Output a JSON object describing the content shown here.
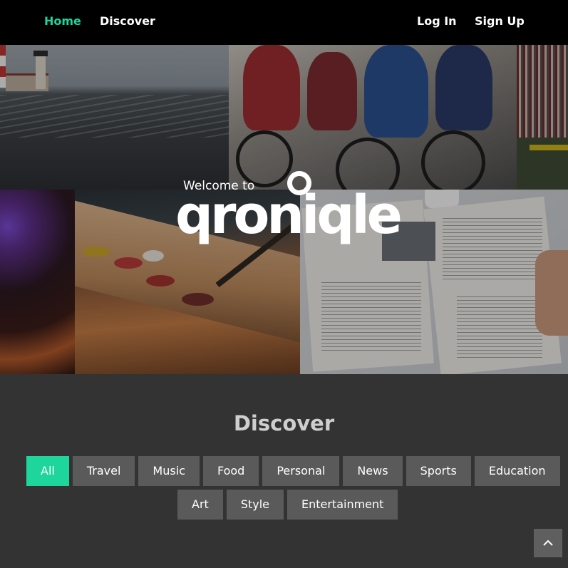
{
  "nav": {
    "home": "Home",
    "discover": "Discover",
    "login": "Log In",
    "signup": "Sign Up",
    "active_color": "#1ed69b"
  },
  "hero": {
    "welcome": "Welcome to",
    "logo_text": "qroniqle"
  },
  "discover": {
    "title": "Discover",
    "filters": [
      "All",
      "Travel",
      "Music",
      "Food",
      "Personal",
      "News",
      "Sports",
      "Education",
      "Art",
      "Style",
      "Entertainment"
    ],
    "active_filter": "All"
  },
  "icons": {
    "back_to_top": "chevron-up-icon"
  }
}
